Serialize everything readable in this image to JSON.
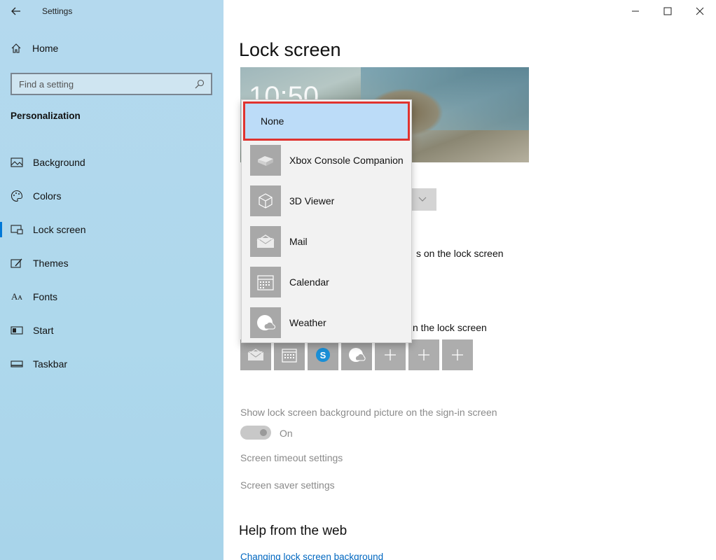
{
  "app": {
    "title": "Settings"
  },
  "sidebar": {
    "home_label": "Home",
    "search_placeholder": "Find a setting",
    "section_title": "Personalization",
    "items": [
      {
        "label": "Background",
        "icon": "image-icon"
      },
      {
        "label": "Colors",
        "icon": "palette-icon"
      },
      {
        "label": "Lock screen",
        "icon": "lock-screen-icon",
        "active": true
      },
      {
        "label": "Themes",
        "icon": "themes-icon"
      },
      {
        "label": "Fonts",
        "icon": "fonts-icon"
      },
      {
        "label": "Start",
        "icon": "start-icon"
      },
      {
        "label": "Taskbar",
        "icon": "taskbar-icon"
      }
    ]
  },
  "main": {
    "title": "Lock screen",
    "preview_time": "10:50",
    "partial_text_1": "s on the lock screen",
    "partial_text_2": "n the lock screen",
    "signin_label": "Show lock screen background picture on the sign-in screen",
    "toggle_state": "On",
    "screen_timeout_link": "Screen timeout settings",
    "screen_saver_link": "Screen saver settings",
    "help_title": "Help from the web",
    "help_link": "Changing lock screen background"
  },
  "dropdown": {
    "selected": "None",
    "options": [
      {
        "label": "Xbox Console Companion",
        "icon": "xbox-app-icon"
      },
      {
        "label": "3D Viewer",
        "icon": "3d-viewer-icon"
      },
      {
        "label": "Mail",
        "icon": "mail-icon"
      },
      {
        "label": "Calendar",
        "icon": "calendar-icon"
      },
      {
        "label": "Weather",
        "icon": "weather-icon"
      }
    ]
  },
  "quick_status": {
    "tiles": [
      "mail-icon",
      "calendar-icon",
      "skype-icon",
      "weather-icon",
      "add-icon",
      "add-icon",
      "add-icon"
    ],
    "skype_letter": "S"
  },
  "colors": {
    "accent": "#0078d7",
    "highlight_border": "#e0332f",
    "selected_bg": "#bcdcf8"
  }
}
